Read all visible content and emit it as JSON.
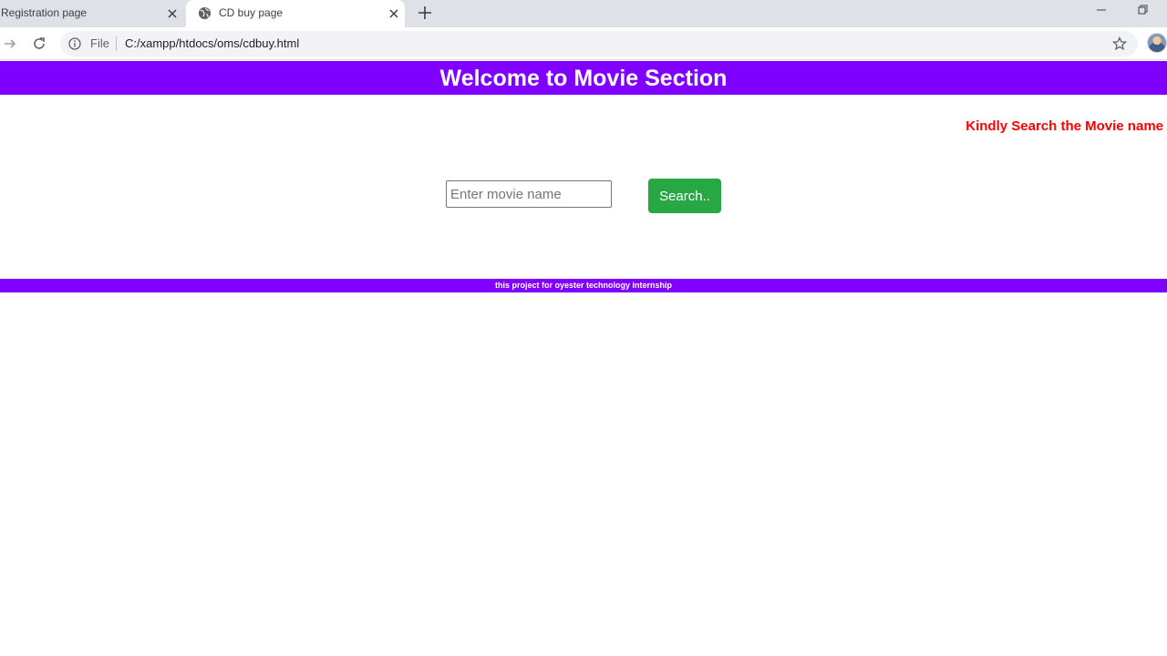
{
  "browser": {
    "tabs": [
      {
        "title": "Registration page",
        "active": false
      },
      {
        "title": "CD buy page",
        "active": true
      }
    ],
    "address": {
      "scheme_label": "File",
      "url": "C:/xampp/htdocs/oms/cdbuy.html"
    }
  },
  "page": {
    "header_title": "Welcome to Movie Section",
    "notice": "Kindly Search the Movie name",
    "search": {
      "placeholder": "Enter movie name",
      "value": "",
      "button_label": "Search.."
    },
    "footer_text": "this project for oyester technology internship"
  },
  "colors": {
    "brand_purple": "#8000ff",
    "notice_red": "#ff0000",
    "button_green": "#28a745"
  }
}
